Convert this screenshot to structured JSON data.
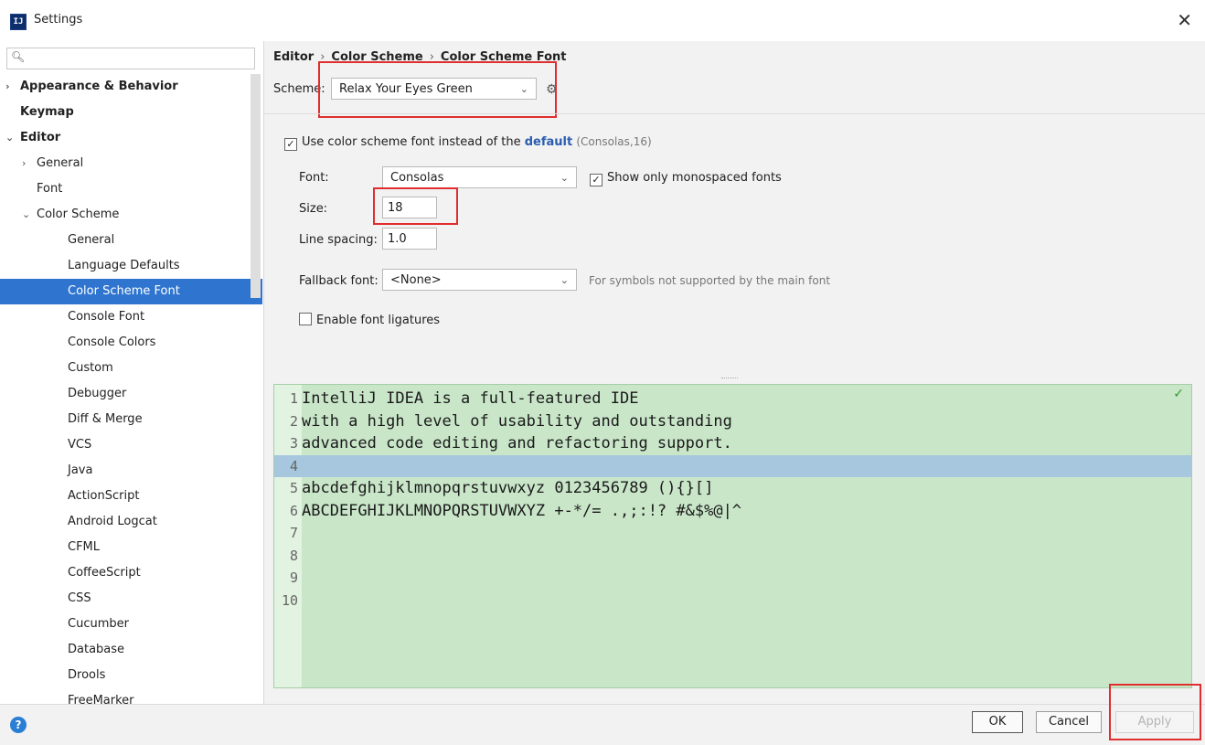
{
  "window": {
    "title": "Settings",
    "app_icon": "IJ",
    "close_glyph": "✕"
  },
  "sidebar": {
    "search_placeholder": "",
    "items": [
      {
        "label": "Appearance & Behavior",
        "level": 0,
        "arrow": "›",
        "bold": true
      },
      {
        "label": "Keymap",
        "level": 0,
        "arrow": "",
        "bold": true
      },
      {
        "label": "Editor",
        "level": 0,
        "arrow": "⌄",
        "bold": true
      },
      {
        "label": "General",
        "level": 1,
        "arrow": "›"
      },
      {
        "label": "Font",
        "level": 1,
        "arrow": ""
      },
      {
        "label": "Color Scheme",
        "level": 1,
        "arrow": "⌄"
      },
      {
        "label": "General",
        "level": 2,
        "arrow": ""
      },
      {
        "label": "Language Defaults",
        "level": 2,
        "arrow": ""
      },
      {
        "label": "Color Scheme Font",
        "level": 2,
        "arrow": "",
        "selected": true
      },
      {
        "label": "Console Font",
        "level": 2,
        "arrow": ""
      },
      {
        "label": "Console Colors",
        "level": 2,
        "arrow": ""
      },
      {
        "label": "Custom",
        "level": 2,
        "arrow": ""
      },
      {
        "label": "Debugger",
        "level": 2,
        "arrow": ""
      },
      {
        "label": "Diff & Merge",
        "level": 2,
        "arrow": ""
      },
      {
        "label": "VCS",
        "level": 2,
        "arrow": ""
      },
      {
        "label": "Java",
        "level": 2,
        "arrow": ""
      },
      {
        "label": "ActionScript",
        "level": 2,
        "arrow": ""
      },
      {
        "label": "Android Logcat",
        "level": 2,
        "arrow": ""
      },
      {
        "label": "CFML",
        "level": 2,
        "arrow": ""
      },
      {
        "label": "CoffeeScript",
        "level": 2,
        "arrow": ""
      },
      {
        "label": "CSS",
        "level": 2,
        "arrow": ""
      },
      {
        "label": "Cucumber",
        "level": 2,
        "arrow": ""
      },
      {
        "label": "Database",
        "level": 2,
        "arrow": ""
      },
      {
        "label": "Drools",
        "level": 2,
        "arrow": ""
      },
      {
        "label": "FreeMarker",
        "level": 2,
        "arrow": ""
      }
    ]
  },
  "breadcrumb": {
    "part1": "Editor",
    "part2": "Color Scheme",
    "part3": "Color Scheme Font",
    "sep": "›"
  },
  "scheme": {
    "label": "Scheme:",
    "value": "Relax Your Eyes Green"
  },
  "use_scheme_font": {
    "checked": "✓",
    "text": "Use color scheme font instead of the",
    "link": "default",
    "hint": "(Consolas,16)"
  },
  "font": {
    "label": "Font:",
    "value": "Consolas"
  },
  "monospaced": {
    "checked": "✓",
    "text": "Show only monospaced fonts"
  },
  "size": {
    "label": "Size:",
    "value": "18"
  },
  "line_spacing": {
    "label": "Line spacing:",
    "value": "1.0"
  },
  "fallback": {
    "label": "Fallback font:",
    "value": "<None>",
    "hint": "For symbols not supported by the main font"
  },
  "ligatures": {
    "checked": "",
    "text": "Enable font ligatures"
  },
  "preview": {
    "lines": [
      {
        "num": "1",
        "text": "IntelliJ IDEA is a full-featured IDE"
      },
      {
        "num": "2",
        "text": "with a high level of usability and outstanding"
      },
      {
        "num": "3",
        "text": "advanced code editing and refactoring support."
      },
      {
        "num": "4",
        "text": "",
        "current": true
      },
      {
        "num": "5",
        "text": "abcdefghijklmnopqrstuvwxyz 0123456789 (){}[]"
      },
      {
        "num": "6",
        "text": "ABCDEFGHIJKLMNOPQRSTUVWXYZ +-*/= .,;:!? #&$%@|^"
      },
      {
        "num": "7",
        "text": ""
      },
      {
        "num": "8",
        "text": ""
      },
      {
        "num": "9",
        "text": ""
      },
      {
        "num": "10",
        "text": ""
      }
    ]
  },
  "buttons": {
    "ok": "OK",
    "cancel": "Cancel",
    "apply": "Apply",
    "help": "?"
  },
  "colors": {
    "selection": "#2f75cf",
    "preview_bg": "#c9e6c9",
    "current_line": "#a6c7dd",
    "highlight": "#e02e2e",
    "link": "#2a5db0"
  }
}
